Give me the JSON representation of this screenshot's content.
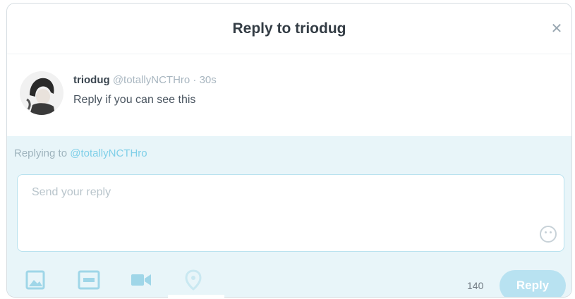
{
  "dialog": {
    "title": "Reply to triodug",
    "close_icon": "close-icon"
  },
  "tweet": {
    "author_name": "triodug",
    "author_handle": "@totallyNCTHro",
    "separator": " · ",
    "time_ago": "30s",
    "text": "Reply if you can see this",
    "avatar_icon": "avatar"
  },
  "reply": {
    "replying_to_label": "Replying to",
    "replying_to_handle": "@totallyNCTHro",
    "placeholder": "Send your reply",
    "char_count": "140",
    "button_label": "Reply"
  },
  "toolbar": {
    "icons": [
      "image-icon",
      "gif-icon",
      "video-icon",
      "location-icon",
      "emoji-icon"
    ]
  },
  "colors": {
    "accent": "#7fcfe8",
    "reply_bg": "#e8f5f9",
    "button_bg": "#b8e2f1"
  }
}
